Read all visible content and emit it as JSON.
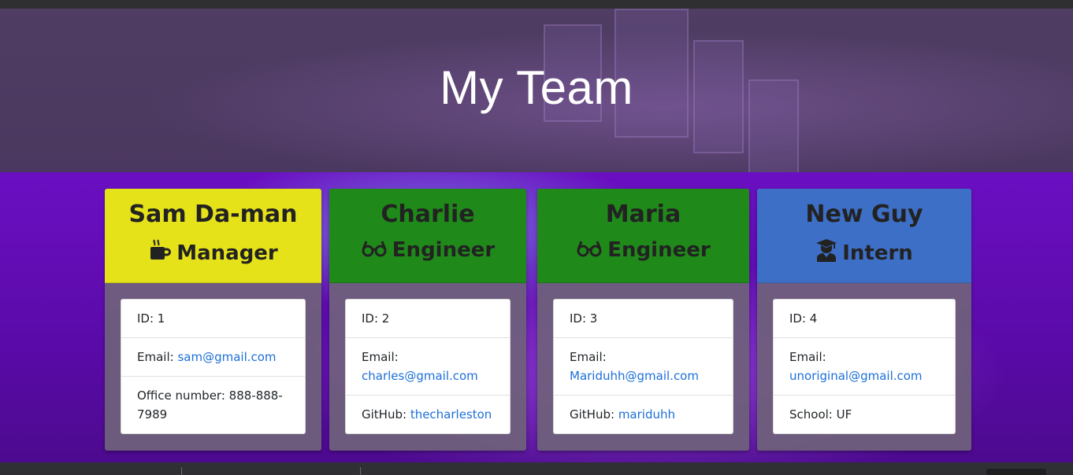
{
  "header": {
    "title": "My Team"
  },
  "team": [
    {
      "name": "Sam Da-man",
      "role": "Manager",
      "role_icon": "coffee-mug-icon",
      "color": "#e6e21a",
      "id_label": "ID: ",
      "id": "1",
      "email_label": "Email: ",
      "email": "sam@gmail.com",
      "extra_label": "Office number: ",
      "extra_value": "888-888-7989"
    },
    {
      "name": "Charlie",
      "role": "Engineer",
      "role_icon": "glasses-icon",
      "color": "#1f8a1a",
      "id_label": "ID: ",
      "id": "2",
      "email_label": "Email: ",
      "email": "charles@gmail.com",
      "extra_label": "GitHub: ",
      "extra_value": "thecharleston"
    },
    {
      "name": "Maria",
      "role": "Engineer",
      "role_icon": "glasses-icon",
      "color": "#1f8a1a",
      "id_label": "ID: ",
      "id": "3",
      "email_label": "Email: ",
      "email": "Mariduhh@gmail.com",
      "extra_label": "GitHub: ",
      "extra_value": "mariduhh"
    },
    {
      "name": "New Guy",
      "role": "Intern",
      "role_icon": "graduate-icon",
      "color": "#3d6fc6",
      "id_label": "ID: ",
      "id": "4",
      "email_label": "Email: ",
      "email": "unoriginal@gmail.com",
      "extra_label": "School: ",
      "extra_value": "UF"
    }
  ],
  "colors": {
    "link": "#1c6fd9",
    "card_body": "#6e5f7d"
  }
}
